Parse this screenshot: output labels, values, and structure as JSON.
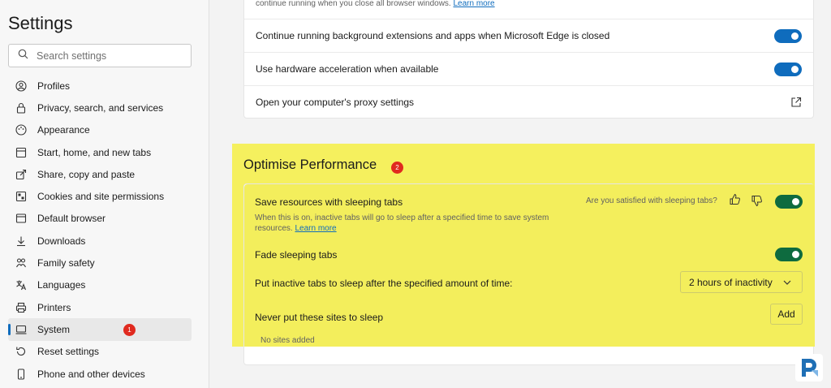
{
  "sidebar": {
    "title": "Settings",
    "search_placeholder": "Search settings",
    "items": [
      {
        "label": "Profiles",
        "icon": "profile-icon"
      },
      {
        "label": "Privacy, search, and services",
        "icon": "lock-icon"
      },
      {
        "label": "Appearance",
        "icon": "palette-icon"
      },
      {
        "label": "Start, home, and new tabs",
        "icon": "home-tabs-icon"
      },
      {
        "label": "Share, copy and paste",
        "icon": "share-icon"
      },
      {
        "label": "Cookies and site permissions",
        "icon": "cookies-icon"
      },
      {
        "label": "Default browser",
        "icon": "browser-icon"
      },
      {
        "label": "Downloads",
        "icon": "download-icon"
      },
      {
        "label": "Family safety",
        "icon": "family-icon"
      },
      {
        "label": "Languages",
        "icon": "language-icon"
      },
      {
        "label": "Printers",
        "icon": "printer-icon"
      },
      {
        "label": "System",
        "icon": "system-icon",
        "active": true
      },
      {
        "label": "Reset settings",
        "icon": "reset-icon"
      },
      {
        "label": "Phone and other devices",
        "icon": "phone-icon"
      }
    ],
    "system_badge": "1"
  },
  "system": {
    "partial_text": "continue running when you close all browser windows.",
    "partial_link": "Learn more",
    "rows": [
      {
        "label": "Continue running background extensions and apps when Microsoft Edge is closed",
        "state": "on"
      },
      {
        "label": "Use hardware acceleration when available",
        "state": "on"
      },
      {
        "label": "Open your computer's proxy settings",
        "icon": "external-link-icon"
      }
    ]
  },
  "performance": {
    "title": "Optimise Performance",
    "badge": "2",
    "sleeping_tabs_label": "Save resources with sleeping tabs",
    "sleeping_tabs_desc": "When this is on, inactive tabs will go to sleep after a specified time to save system resources.",
    "learn_more": "Learn more",
    "feedback_question": "Are you satisfied with sleeping tabs?",
    "fade_label": "Fade sleeping tabs",
    "sleep_after_label": "Put inactive tabs to sleep after the specified amount of time:",
    "sleep_after_value": "2 hours of inactivity",
    "never_sleep_label": "Never put these sites to sleep",
    "add_label": "Add",
    "no_sites": "No sites added"
  },
  "colors": {
    "accent_blue": "#0f6cbd",
    "toggle_green": "#0e6b3f",
    "highlight_yellow": "#f5f05e",
    "badge_red": "#e02a1f"
  }
}
